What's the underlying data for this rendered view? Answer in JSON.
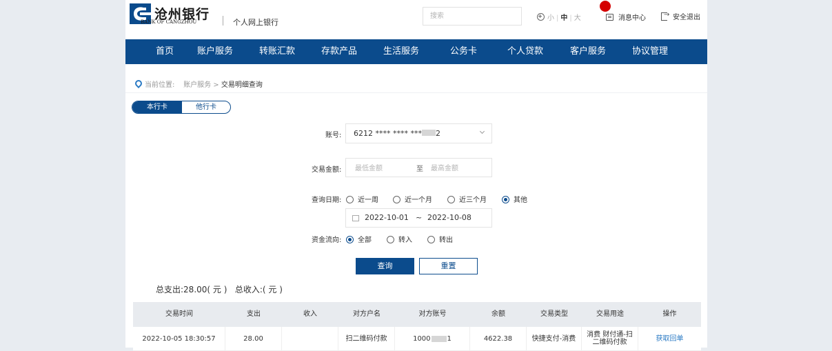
{
  "header": {
    "logo_cn": "沧州银行",
    "logo_en": "BANK OF CANGZHOU",
    "subtitle": "个人网上银行",
    "search_placeholder": "搜索",
    "font_small": "小",
    "font_medium": "中",
    "font_large": "大",
    "message_center": "消息中心",
    "logout": "安全退出",
    "brand_color": "#0b4b8c",
    "badge_color": "#d40000"
  },
  "nav": {
    "items": [
      "首页",
      "账户服务",
      "转账汇款",
      "存款产品",
      "生活服务",
      "公务卡",
      "个人贷款",
      "客户服务",
      "协议管理"
    ]
  },
  "breadcrumb": {
    "prefix": "当前位置:",
    "parent": "账户服务",
    "separator": ">",
    "current": "交易明细查询"
  },
  "card_tabs": {
    "active": "本行卡",
    "inactive": "他行卡"
  },
  "form": {
    "account_label": "账号:",
    "account_value_prefix": "6212 **** **** ***",
    "account_value_suffix": "2",
    "amount_label": "交易金额:",
    "amount_min_placeholder": "最低金额",
    "amount_to": "至",
    "amount_max_placeholder": "最高金额",
    "date_label": "查询日期:",
    "date_options": [
      "近一周",
      "近一个月",
      "近三个月",
      "其他"
    ],
    "date_selected": "其他",
    "date_start": "2022-10-01",
    "date_dash": "~",
    "date_end": "2022-10-08",
    "flow_label": "资金流向:",
    "flow_options": [
      "全部",
      "转入",
      "转出"
    ],
    "flow_selected": "全部",
    "query_button": "查询",
    "reset_button": "重置"
  },
  "summary": {
    "expense_label": "总支出:",
    "expense_value": "28.00",
    "expense_unit": "( 元 )",
    "income_label": "总收入:",
    "income_value": "",
    "income_unit": "( 元 )"
  },
  "table": {
    "headers": [
      "交易时间",
      "支出",
      "收入",
      "对方户名",
      "对方账号",
      "余额",
      "交易类型",
      "交易用途",
      "操作"
    ],
    "rows": [
      {
        "time": "2022-10-05 18:30:57",
        "expense": "28.00",
        "income": "",
        "counterparty": "扫二维码付款",
        "account_prefix": "1000",
        "account_suffix": "1",
        "balance": "4622.38",
        "type": "快捷支付-消费",
        "purpose": "消费 财付通-扫二维码付款",
        "action": "获取回单"
      }
    ]
  }
}
